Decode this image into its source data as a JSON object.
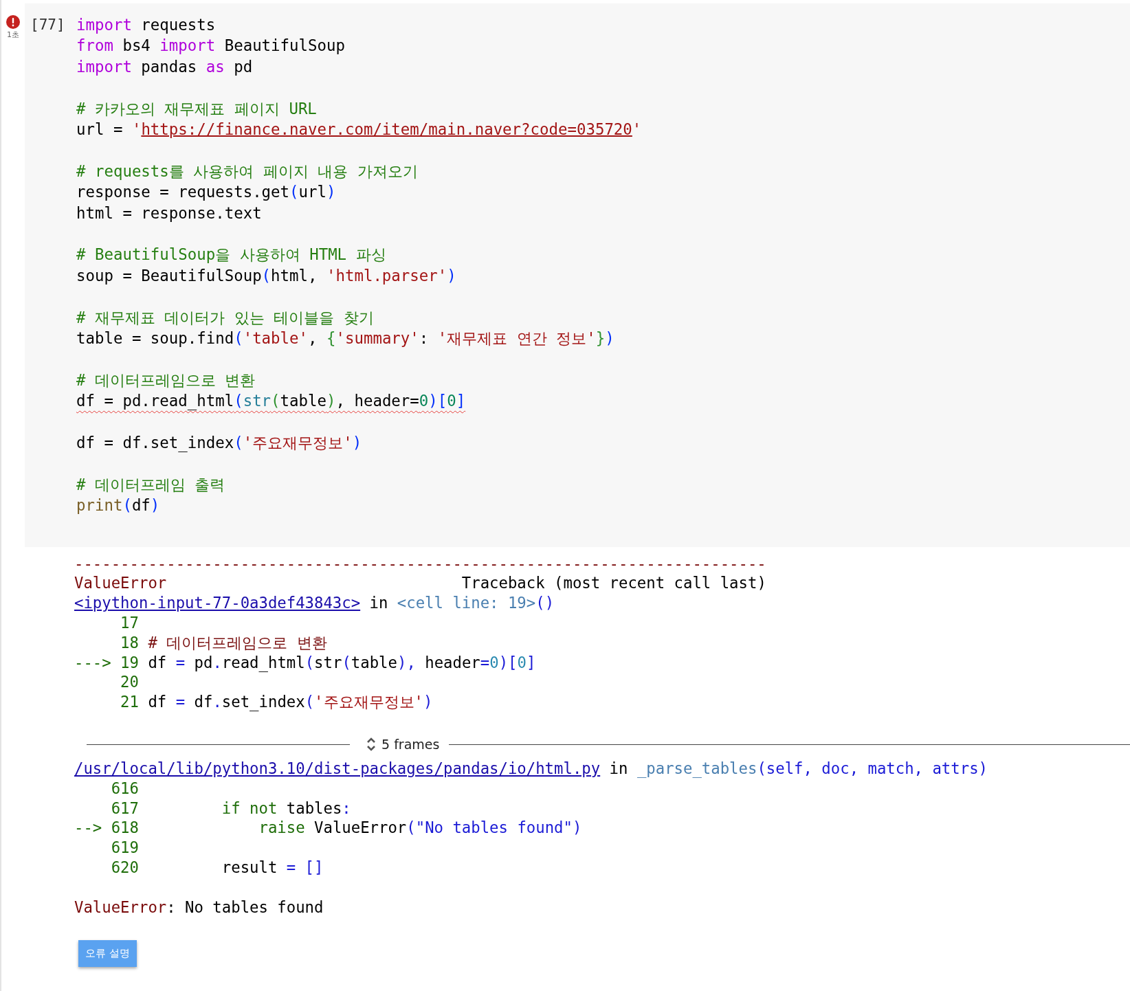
{
  "cell": {
    "execution_count": "[77]",
    "error": true,
    "duration": "1초",
    "code_blocks": [
      [
        {
          "squiggle": false,
          "tokens": [
            {
              "kind": "keyword",
              "text": "import"
            },
            {
              "kind": "plain",
              "text": " requests"
            }
          ]
        },
        {
          "squiggle": false,
          "tokens": [
            {
              "kind": "keyword",
              "text": "from"
            },
            {
              "kind": "plain",
              "text": " bs4 "
            },
            {
              "kind": "keyword",
              "text": "import"
            },
            {
              "kind": "plain",
              "text": " BeautifulSoup"
            }
          ]
        },
        {
          "squiggle": false,
          "tokens": [
            {
              "kind": "keyword",
              "text": "import"
            },
            {
              "kind": "plain",
              "text": " pandas "
            },
            {
              "kind": "keyword",
              "text": "as"
            },
            {
              "kind": "plain",
              "text": " pd"
            }
          ]
        }
      ],
      [
        {
          "squiggle": false,
          "tokens": [
            {
              "kind": "comment",
              "text": "# 카카오의 재무제표 페이지 URL"
            }
          ]
        },
        {
          "squiggle": false,
          "tokens": [
            {
              "kind": "plain",
              "text": "url = "
            },
            {
              "kind": "string",
              "text": "'"
            },
            {
              "kind": "url",
              "text": "https://finance.naver.com/item/main.naver?code=035720"
            },
            {
              "kind": "string",
              "text": "'"
            }
          ]
        }
      ],
      [
        {
          "squiggle": false,
          "tokens": [
            {
              "kind": "comment",
              "text": "# requests를 사용하여 페이지 내용 가져오기"
            }
          ]
        },
        {
          "squiggle": false,
          "tokens": [
            {
              "kind": "plain",
              "text": "response = requests.get"
            },
            {
              "kind": "paren",
              "text": "("
            },
            {
              "kind": "plain",
              "text": "url"
            },
            {
              "kind": "paren",
              "text": ")"
            }
          ]
        },
        {
          "squiggle": false,
          "tokens": [
            {
              "kind": "plain",
              "text": "html = response.text"
            }
          ]
        }
      ],
      [
        {
          "squiggle": false,
          "tokens": [
            {
              "kind": "comment",
              "text": "# BeautifulSoup을 사용하여 HTML 파싱"
            }
          ]
        },
        {
          "squiggle": false,
          "tokens": [
            {
              "kind": "plain",
              "text": "soup = BeautifulSoup"
            },
            {
              "kind": "paren",
              "text": "("
            },
            {
              "kind": "plain",
              "text": "html, "
            },
            {
              "kind": "string",
              "text": "'html.parser'"
            },
            {
              "kind": "paren",
              "text": ")"
            }
          ]
        }
      ],
      [
        {
          "squiggle": false,
          "tokens": [
            {
              "kind": "comment",
              "text": "# 재무제표 데이터가 있는 테이블을 찾기"
            }
          ]
        },
        {
          "squiggle": false,
          "tokens": [
            {
              "kind": "plain",
              "text": "table = soup.find"
            },
            {
              "kind": "paren",
              "text": "("
            },
            {
              "kind": "string",
              "text": "'table'"
            },
            {
              "kind": "plain",
              "text": ", "
            },
            {
              "kind": "brace",
              "text": "{"
            },
            {
              "kind": "string",
              "text": "'summary'"
            },
            {
              "kind": "plain",
              "text": ": "
            },
            {
              "kind": "string",
              "text": "'재무제표 연간 정보'"
            },
            {
              "kind": "brace",
              "text": "}"
            },
            {
              "kind": "paren",
              "text": ")"
            }
          ]
        }
      ],
      [
        {
          "squiggle": false,
          "tokens": [
            {
              "kind": "comment",
              "text": "# 데이터프레임으로 변환"
            }
          ]
        },
        {
          "squiggle": true,
          "tokens": [
            {
              "kind": "plain",
              "text": "df = pd.read_html"
            },
            {
              "kind": "paren",
              "text": "("
            },
            {
              "kind": "builtin",
              "text": "str"
            },
            {
              "kind": "brace",
              "text": "("
            },
            {
              "kind": "plain",
              "text": "table"
            },
            {
              "kind": "brace",
              "text": ")"
            },
            {
              "kind": "plain",
              "text": ", header="
            },
            {
              "kind": "number",
              "text": "0"
            },
            {
              "kind": "paren",
              "text": ")["
            },
            {
              "kind": "number",
              "text": "0"
            },
            {
              "kind": "paren",
              "text": "]"
            }
          ]
        }
      ],
      [
        {
          "squiggle": false,
          "tokens": [
            {
              "kind": "plain",
              "text": "df = df.set_index"
            },
            {
              "kind": "paren",
              "text": "("
            },
            {
              "kind": "string",
              "text": "'주요재무정보'"
            },
            {
              "kind": "paren",
              "text": ")"
            }
          ]
        }
      ],
      [
        {
          "squiggle": false,
          "tokens": [
            {
              "kind": "comment",
              "text": "# 데이터프레임 출력"
            }
          ]
        },
        {
          "squiggle": false,
          "tokens": [
            {
              "kind": "func",
              "text": "print"
            },
            {
              "kind": "paren",
              "text": "("
            },
            {
              "kind": "plain",
              "text": "df"
            },
            {
              "kind": "paren",
              "text": ")"
            }
          ]
        }
      ]
    ]
  },
  "output": {
    "first_frame": [
      {
        "tokens": [
          {
            "kind": "error",
            "text": "---------------------------------------------------------------------------"
          }
        ]
      },
      {
        "tokens": [
          {
            "kind": "error",
            "text": "ValueError"
          },
          {
            "kind": "plain",
            "text": "                                Traceback (most recent call last)"
          }
        ]
      },
      {
        "tokens": [
          {
            "kind": "link",
            "text": "<ipython-input-77-0a3def43843c>"
          },
          {
            "kind": "plain",
            "text": " in "
          },
          {
            "kind": "funcref",
            "text": "<cell line: 19>"
          },
          {
            "kind": "op",
            "text": "()"
          }
        ]
      },
      {
        "tokens": [
          {
            "kind": "lineno",
            "text": "     17"
          }
        ]
      },
      {
        "tokens": [
          {
            "kind": "lineno",
            "text": "     18 "
          },
          {
            "kind": "tbcomment",
            "text": "# 데이터프레임으로 변환"
          }
        ]
      },
      {
        "tokens": [
          {
            "kind": "lineno",
            "text": "---> 19 "
          },
          {
            "kind": "plain",
            "text": "df "
          },
          {
            "kind": "op",
            "text": "="
          },
          {
            "kind": "plain",
            "text": " pd"
          },
          {
            "kind": "op",
            "text": "."
          },
          {
            "kind": "plain",
            "text": "read_html"
          },
          {
            "kind": "op",
            "text": "("
          },
          {
            "kind": "plain",
            "text": "str"
          },
          {
            "kind": "op",
            "text": "("
          },
          {
            "kind": "plain",
            "text": "table"
          },
          {
            "kind": "op",
            "text": "),"
          },
          {
            "kind": "plain",
            "text": " header"
          },
          {
            "kind": "op",
            "text": "="
          },
          {
            "kind": "tbnumber",
            "text": "0"
          },
          {
            "kind": "op",
            "text": ")["
          },
          {
            "kind": "tbnumber",
            "text": "0"
          },
          {
            "kind": "op",
            "text": "]"
          }
        ]
      },
      {
        "tokens": [
          {
            "kind": "lineno",
            "text": "     20"
          }
        ]
      },
      {
        "tokens": [
          {
            "kind": "lineno",
            "text": "     21 "
          },
          {
            "kind": "plain",
            "text": "df "
          },
          {
            "kind": "op",
            "text": "="
          },
          {
            "kind": "plain",
            "text": " df"
          },
          {
            "kind": "op",
            "text": "."
          },
          {
            "kind": "plain",
            "text": "set_index"
          },
          {
            "kind": "op",
            "text": "("
          },
          {
            "kind": "tbstring",
            "text": "'주요재무정보'"
          },
          {
            "kind": "op",
            "text": ")"
          }
        ]
      }
    ],
    "frames_toggle": "5 frames",
    "second_frame": [
      {
        "tokens": [
          {
            "kind": "link",
            "text": "/usr/local/lib/python3.10/dist-packages/pandas/io/html.py"
          },
          {
            "kind": "plain",
            "text": " in "
          },
          {
            "kind": "funcref",
            "text": "_parse_tables"
          },
          {
            "kind": "op",
            "text": "(self, doc, match, attrs)"
          }
        ]
      },
      {
        "tokens": [
          {
            "kind": "lineno",
            "text": "    616"
          }
        ]
      },
      {
        "tokens": [
          {
            "kind": "lineno",
            "text": "    617 "
          },
          {
            "kind": "tbkeyword",
            "text": "        if"
          },
          {
            "kind": "tbkeyword",
            "text": " not"
          },
          {
            "kind": "plain",
            "text": " tables"
          },
          {
            "kind": "op",
            "text": ":"
          }
        ]
      },
      {
        "tokens": [
          {
            "kind": "lineno",
            "text": "--> 618 "
          },
          {
            "kind": "tbkeyword",
            "text": "            raise"
          },
          {
            "kind": "plain",
            "text": " ValueError"
          },
          {
            "kind": "op",
            "text": "(\"No tables found\")"
          }
        ]
      },
      {
        "tokens": [
          {
            "kind": "lineno",
            "text": "    619"
          }
        ]
      },
      {
        "tokens": [
          {
            "kind": "lineno",
            "text": "    620 "
          },
          {
            "kind": "plain",
            "text": "        result "
          },
          {
            "kind": "op",
            "text": "= []"
          }
        ]
      }
    ],
    "error_message": [
      {
        "kind": "error",
        "text": "ValueError"
      },
      {
        "kind": "plain",
        "text": ": No tables found"
      }
    ],
    "explain_button": "오류 설명"
  }
}
